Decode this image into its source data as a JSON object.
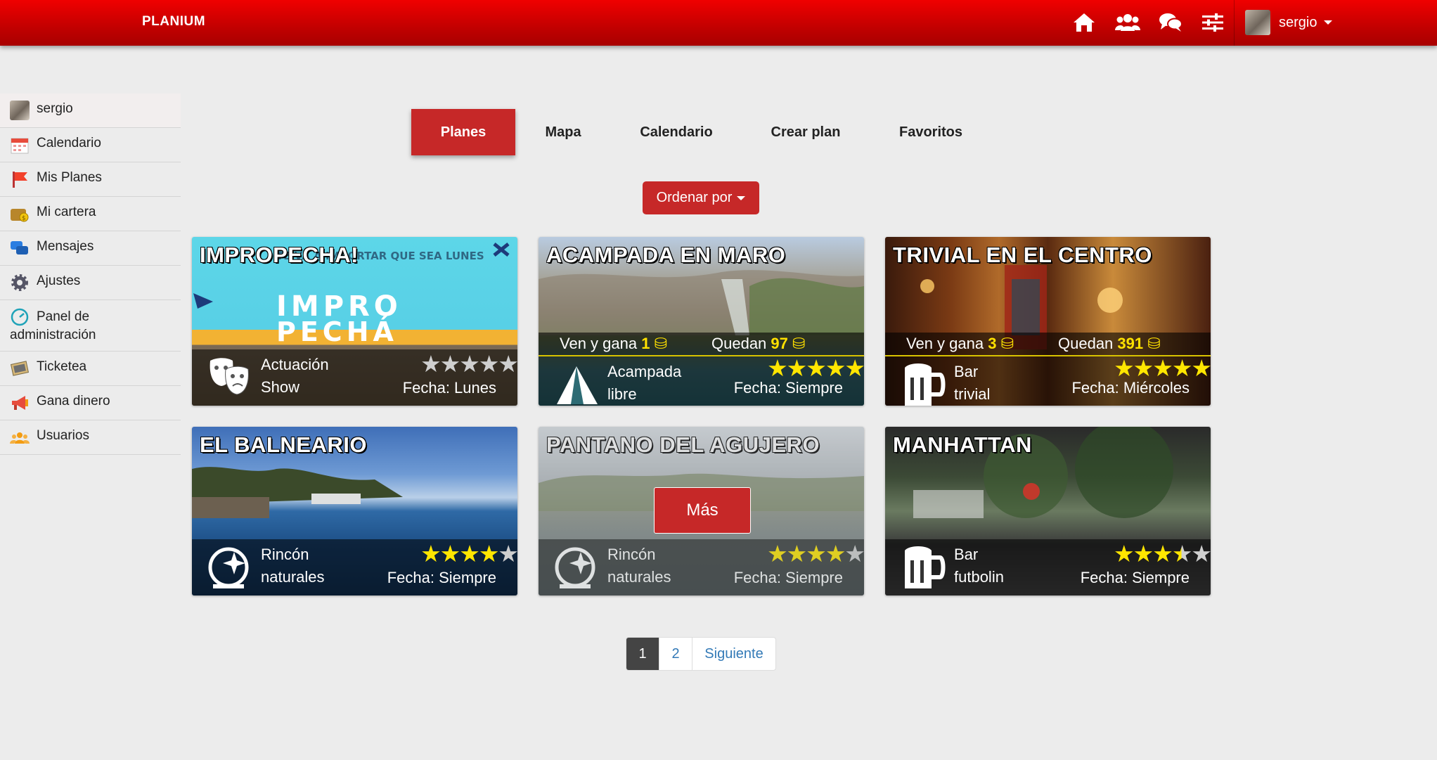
{
  "app": {
    "brand": "PLANIUM",
    "user": "sergio"
  },
  "nav_icons": [
    "home-icon",
    "users-icon",
    "chat-icon",
    "sliders-icon"
  ],
  "sidebar": {
    "items": [
      {
        "label": "sergio",
        "icon": "avatar"
      },
      {
        "label": "Calendario",
        "icon": "calendar-icon"
      },
      {
        "label": "Mis Planes",
        "icon": "flag-icon"
      },
      {
        "label": "Mi cartera",
        "icon": "wallet-icon"
      },
      {
        "label": "Mensajes",
        "icon": "messages-icon"
      },
      {
        "label": "Ajustes",
        "icon": "gear-icon"
      },
      {
        "label": "Panel de administración",
        "icon": "dashboard-icon"
      },
      {
        "label": "Ticketea",
        "icon": "ticket-icon"
      },
      {
        "label": "Gana dinero",
        "icon": "megaphone-icon"
      },
      {
        "label": "Usuarios",
        "icon": "users-icon"
      }
    ]
  },
  "tabs": [
    "Planes",
    "Mapa",
    "Calendario",
    "Crear plan",
    "Favoritos"
  ],
  "sort_button": "Ordenar por",
  "cards": [
    {
      "title": "IMPROPECHA!",
      "category": "Actuación",
      "subcategory": "Show",
      "rating": 0,
      "date_label": "Fecha: Lunes",
      "coins_text": null,
      "remaining_text": null,
      "coins": null,
      "remaining": null,
      "category_icon": "theater-masks-icon"
    },
    {
      "title": "ACAMPADA EN MARO",
      "category": "Acampada",
      "subcategory": "libre",
      "rating": 5,
      "date_label": "Fecha: Siempre",
      "coins_text": "Ven y gana",
      "coins": "1",
      "remaining_text": "Quedan",
      "remaining": "97",
      "category_icon": "tent-icon"
    },
    {
      "title": "TRIVIAL EN EL CENTRO",
      "category": "Bar",
      "subcategory": "trivial",
      "rating": 5,
      "date_label": "Fecha: Miércoles",
      "coins_text": "Ven y gana",
      "coins": "3",
      "remaining_text": "Quedan",
      "remaining": "391",
      "category_icon": "beer-mug-icon"
    },
    {
      "title": "EL BALNEARIO",
      "category": "Rincón",
      "subcategory": "naturales",
      "rating": 4,
      "date_label": "Fecha: Siempre",
      "category_icon": "nature-icon"
    },
    {
      "title": "PANTANO DEL AGUJERO",
      "category": "Rincón",
      "subcategory": "naturales",
      "rating": 4,
      "date_label": "Fecha: Siempre",
      "more_button": "Más",
      "category_icon": "nature-icon"
    },
    {
      "title": "MANHATTAN",
      "category": "Bar",
      "subcategory": "futbolin",
      "rating": 3.5,
      "date_label": "Fecha: Siempre",
      "category_icon": "beer-mug-icon"
    }
  ],
  "pagination": {
    "pages": [
      "1",
      "2"
    ],
    "current": "1",
    "next": "Siguiente"
  },
  "colors": {
    "navbar": "#e00000",
    "accent": "#c62828",
    "star": "#ffe600",
    "coin": "#ffe100"
  }
}
